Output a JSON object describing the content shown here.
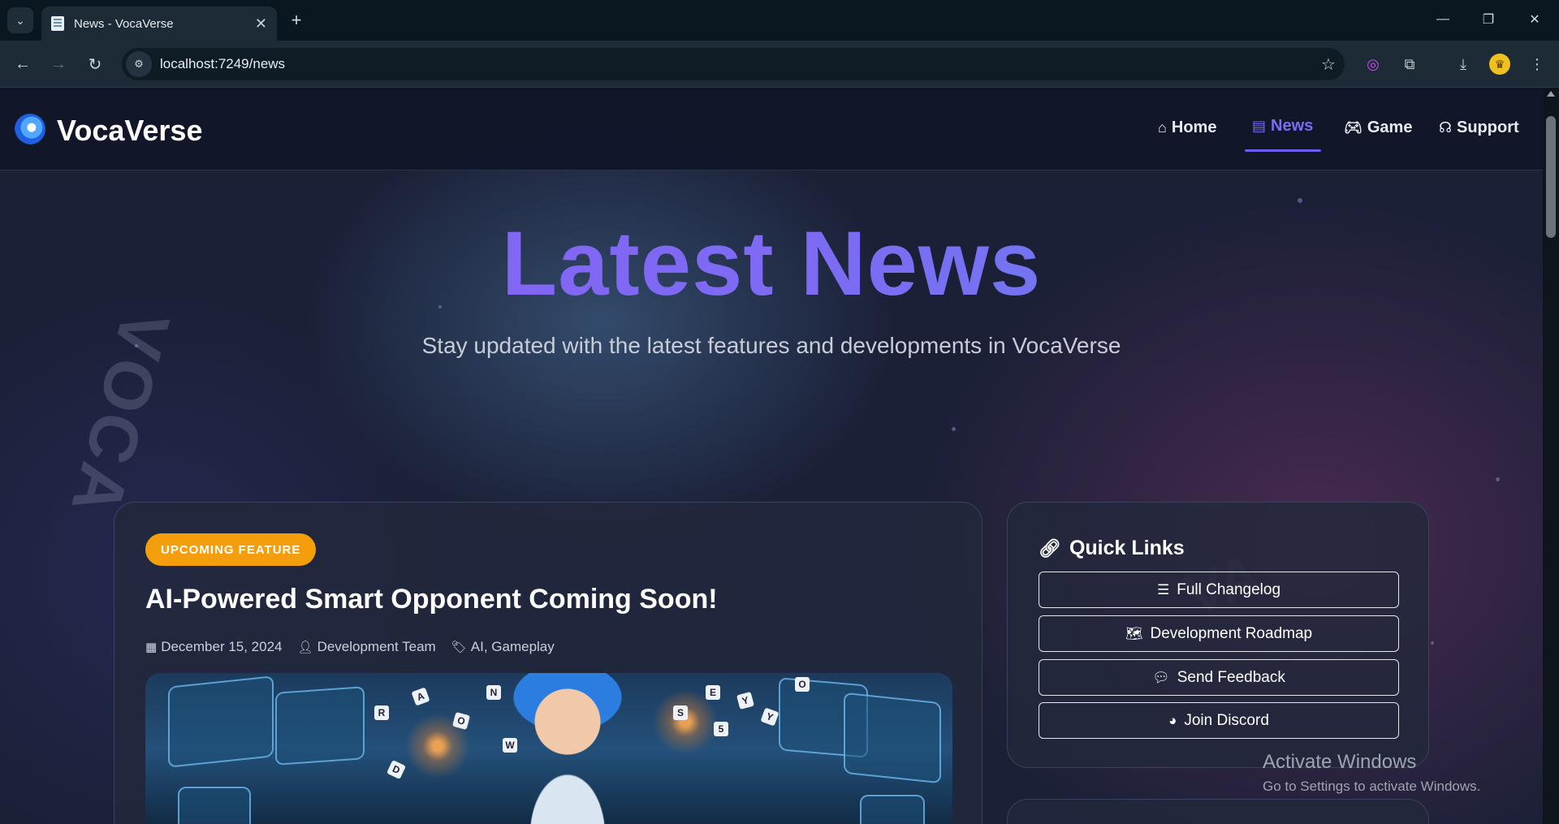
{
  "browser": {
    "tab_title": "News - VocaVerse",
    "url": "localhost:7249/news",
    "icons": [
      "tab-list-icon",
      "close-icon",
      "plus-icon",
      "minimize-icon",
      "restore-icon",
      "window-close-icon",
      "back-icon",
      "forward-icon",
      "reload-icon",
      "site-info-icon",
      "star-icon",
      "extension-icon",
      "puzzle-icon",
      "download-icon",
      "profile-icon",
      "menu-icon"
    ]
  },
  "site": {
    "brand": "VocaVerse",
    "nav": [
      {
        "label": "Home",
        "icon": "home-icon",
        "active": false
      },
      {
        "label": "News",
        "icon": "newspaper-icon",
        "active": true
      },
      {
        "label": "Game",
        "icon": "gamepad-icon",
        "active": false
      },
      {
        "label": "Support",
        "icon": "headset-icon",
        "active": false
      }
    ]
  },
  "hero": {
    "title": "Latest News",
    "subtitle": "Stay updated with the latest features and developments in VocaVerse",
    "deco_word": "VOCA"
  },
  "news": {
    "badge": "UPCOMING FEATURE",
    "title": "AI-Powered Smart Opponent Coming Soon!",
    "date": "December 15, 2024",
    "author": "Development Team",
    "tags": "AI, Gameplay"
  },
  "quick_links": {
    "title": "Quick Links",
    "items": [
      {
        "label": "Full Changelog",
        "icon": "list-icon"
      },
      {
        "label": "Development Roadmap",
        "icon": "map-icon"
      },
      {
        "label": "Send Feedback",
        "icon": "comment-icon"
      },
      {
        "label": "Join Discord",
        "icon": "discord-icon"
      }
    ]
  },
  "watermark": {
    "line1": "Activate Windows",
    "line2": "Go to Settings to activate Windows."
  },
  "colors": {
    "accent": "#7b6cf5",
    "badge": "#f59e0b",
    "page_bg": "#1b2037"
  }
}
